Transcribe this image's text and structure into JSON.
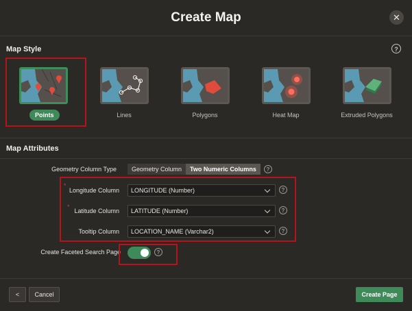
{
  "dialog": {
    "title": "Create Map"
  },
  "map_style": {
    "heading": "Map Style",
    "options": [
      {
        "label": "Points",
        "selected": true
      },
      {
        "label": "Lines",
        "selected": false
      },
      {
        "label": "Polygons",
        "selected": false
      },
      {
        "label": "Heat Map",
        "selected": false
      },
      {
        "label": "Extruded Polygons",
        "selected": false
      }
    ]
  },
  "map_attributes": {
    "heading": "Map Attributes",
    "geometry_type": {
      "label": "Geometry Column Type",
      "options": [
        "Geometry Column",
        "Two Numeric Columns"
      ],
      "selected": "Two Numeric Columns"
    },
    "longitude": {
      "label": "Longitude Column",
      "value": "LONGITUDE (Number)",
      "required": true
    },
    "latitude": {
      "label": "Latitude Column",
      "value": "LATITUDE (Number)",
      "required": true
    },
    "tooltip": {
      "label": "Tooltip Column",
      "value": "LOCATION_NAME (Varchar2)",
      "required": false
    },
    "faceted_search": {
      "label": "Create Faceted Search Page",
      "enabled": true
    }
  },
  "footer": {
    "back_label": "<",
    "cancel_label": "Cancel",
    "create_label": "Create Page"
  },
  "icons": {
    "close": "close-icon",
    "help": "help-icon",
    "chevron": "chevron-down-icon"
  },
  "colors": {
    "accent": "#3e8a58",
    "highlight": "#b6141b",
    "background": "#2b2926"
  }
}
